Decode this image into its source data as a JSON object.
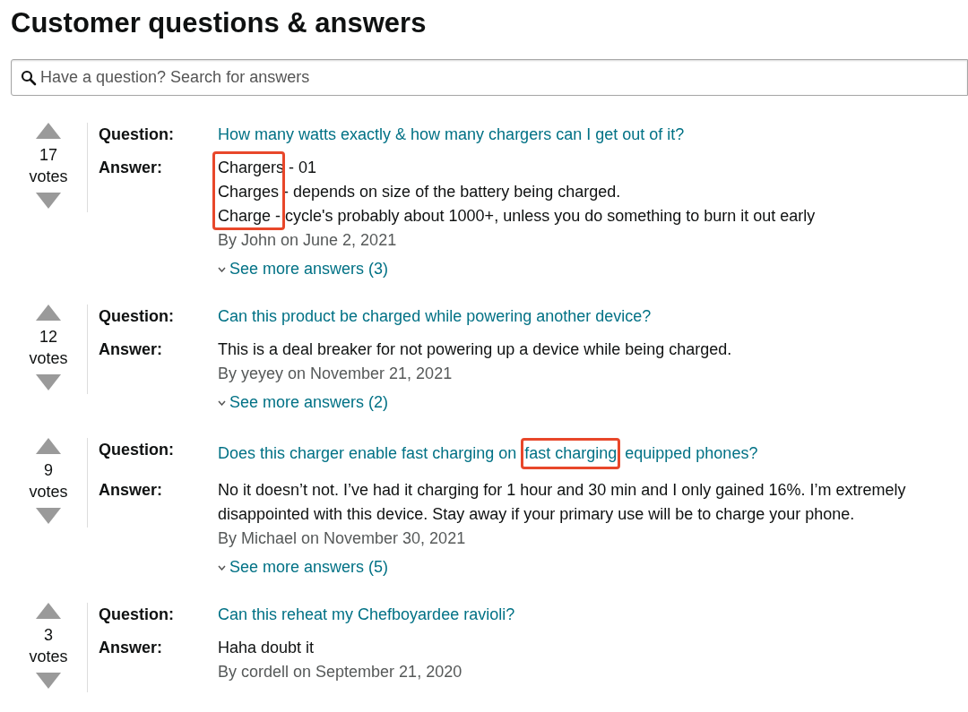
{
  "title": "Customer questions & answers",
  "search": {
    "placeholder": "Have a question? Search for answers"
  },
  "questions": [
    {
      "votes": "17",
      "votes_label": "votes",
      "question_label": "Question:",
      "question": [
        {
          "text": "How many watts exactly & how many chargers can I get out of it?",
          "highlighted": false
        }
      ],
      "answer_label": "Answer:",
      "answer_lines": [
        "Chargers - 01",
        "Charges - depends on size of the battery being charged.",
        "Charge - cycle's probably about 1000+, unless you do something to burn it out early"
      ],
      "answer_highlighted": true,
      "byline": "By John on June 2, 2021",
      "more": "See more answers (3)"
    },
    {
      "votes": "12",
      "votes_label": "votes",
      "question_label": "Question:",
      "question": [
        {
          "text": "Can this product be charged while powering another device?",
          "highlighted": false
        }
      ],
      "answer_label": "Answer:",
      "answer_lines": [
        "This is a deal breaker for not powering up a device while being charged."
      ],
      "answer_highlighted": false,
      "byline": "By yeyey on November 21, 2021",
      "more": "See more answers (2)"
    },
    {
      "votes": "9",
      "votes_label": "votes",
      "question_label": "Question:",
      "question": [
        {
          "text": "Does this charger enable fast charging on ",
          "highlighted": false
        },
        {
          "text": "fast charging",
          "highlighted": true
        },
        {
          "text": " equipped phones?",
          "highlighted": false
        }
      ],
      "answer_label": "Answer:",
      "answer_lines": [
        "No it doesn’t not. I’ve had it charging for 1 hour and 30 min and I only gained 16%. I’m extremely disappointed with this device. Stay away if your primary use will be to charge your phone."
      ],
      "answer_highlighted": false,
      "byline": "By Michael on November 30, 2021",
      "more": "See more answers (5)"
    },
    {
      "votes": "3",
      "votes_label": "votes",
      "question_label": "Question:",
      "question": [
        {
          "text": "Can this reheat my Chefboyardee ravioli?",
          "highlighted": false
        }
      ],
      "answer_label": "Answer:",
      "answer_lines": [
        "Haha doubt it"
      ],
      "answer_highlighted": false,
      "byline": "By cordell on September 21, 2020"
    }
  ]
}
